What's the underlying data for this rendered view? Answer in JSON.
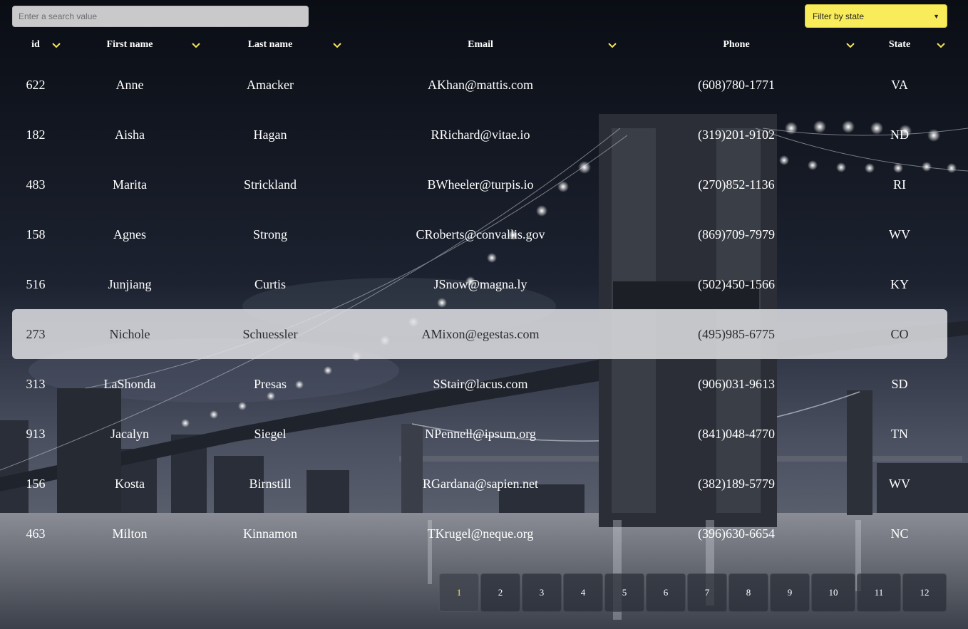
{
  "search": {
    "placeholder": "Enter a search value"
  },
  "filter": {
    "label": "Filter by state"
  },
  "columns": [
    "id",
    "First name",
    "Last name",
    "Email",
    "Phone",
    "State"
  ],
  "rows": [
    {
      "id": "622",
      "first": "Anne",
      "last": "Amacker",
      "email": "AKhan@mattis.com",
      "phone": "(608)780-1771",
      "state": "VA"
    },
    {
      "id": "182",
      "first": "Aisha",
      "last": "Hagan",
      "email": "RRichard@vitae.io",
      "phone": "(319)201-9102",
      "state": "ND"
    },
    {
      "id": "483",
      "first": "Marita",
      "last": "Strickland",
      "email": "BWheeler@turpis.io",
      "phone": "(270)852-1136",
      "state": "RI"
    },
    {
      "id": "158",
      "first": "Agnes",
      "last": "Strong",
      "email": "CRoberts@convallis.gov",
      "phone": "(869)709-7979",
      "state": "WV"
    },
    {
      "id": "516",
      "first": "Junjiang",
      "last": "Curtis",
      "email": "JSnow@magna.ly",
      "phone": "(502)450-1566",
      "state": "KY"
    },
    {
      "id": "273",
      "first": "Nichole",
      "last": "Schuessler",
      "email": "AMixon@egestas.com",
      "phone": "(495)985-6775",
      "state": "CO"
    },
    {
      "id": "313",
      "first": "LaShonda",
      "last": "Presas",
      "email": "SStair@lacus.com",
      "phone": "(906)031-9613",
      "state": "SD"
    },
    {
      "id": "913",
      "first": "Jacalyn",
      "last": "Siegel",
      "email": "NPennell@ipsum.org",
      "phone": "(841)048-4770",
      "state": "TN"
    },
    {
      "id": "156",
      "first": "Kosta",
      "last": "Birnstill",
      "email": "RGardana@sapien.net",
      "phone": "(382)189-5779",
      "state": "WV"
    },
    {
      "id": "463",
      "first": "Milton",
      "last": "Kinnamon",
      "email": "TKrugel@neque.org",
      "phone": "(396)630-6654",
      "state": "NC"
    }
  ],
  "pagination": {
    "pages": [
      "1",
      "2",
      "3",
      "4",
      "5",
      "6",
      "7",
      "8",
      "9",
      "10",
      "11",
      "12"
    ],
    "active": "1"
  },
  "colors": {
    "accent": "#f9ec5a",
    "highlight_row": "#e1e1e4"
  },
  "icons": {
    "sort": "chevron-down-icon",
    "filter": "chevron-down-icon"
  }
}
